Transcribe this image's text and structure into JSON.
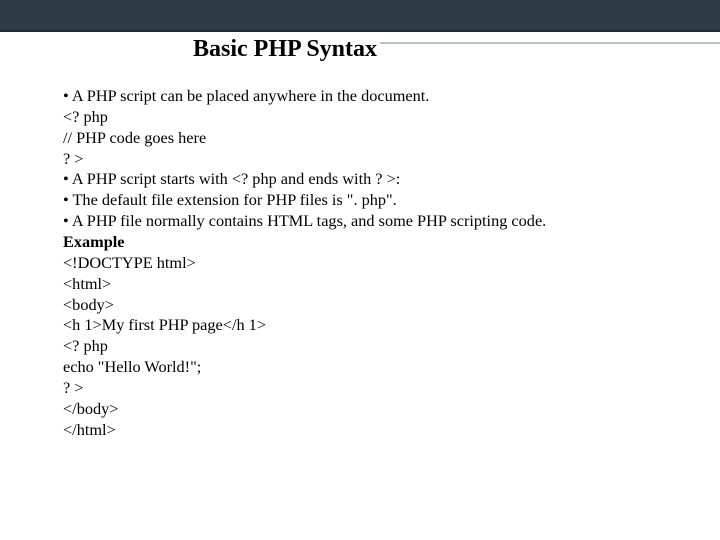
{
  "title": "Basic PHP Syntax",
  "lines": [
    {
      "bullet": true,
      "text": "A PHP script can be placed anywhere in the document."
    },
    {
      "bullet": false,
      "text": "<? php"
    },
    {
      "bullet": false,
      "text": "// PHP code goes here"
    },
    {
      "bullet": false,
      "text": "? >"
    },
    {
      "bullet": true,
      "text": "A PHP script starts with <? php and ends with ? >:"
    },
    {
      "bullet": true,
      "text": "The default file extension for PHP files is \". php\"."
    },
    {
      "bullet": true,
      "text": "A PHP file normally contains HTML tags, and some PHP scripting code."
    },
    {
      "bullet": false,
      "text": "Example",
      "bold": true
    },
    {
      "bullet": false,
      "text": " <!DOCTYPE html>"
    },
    {
      "bullet": false,
      "text": "<html>"
    },
    {
      "bullet": false,
      "text": "<body>"
    },
    {
      "bullet": false,
      "text": "<h 1>My first PHP page</h 1>"
    },
    {
      "bullet": false,
      "text": "<? php"
    },
    {
      "bullet": false,
      "text": "echo \"Hello World!\";"
    },
    {
      "bullet": false,
      "text": "? >"
    },
    {
      "bullet": false,
      "text": "</body>"
    },
    {
      "bullet": false,
      "text": "</html>"
    }
  ]
}
